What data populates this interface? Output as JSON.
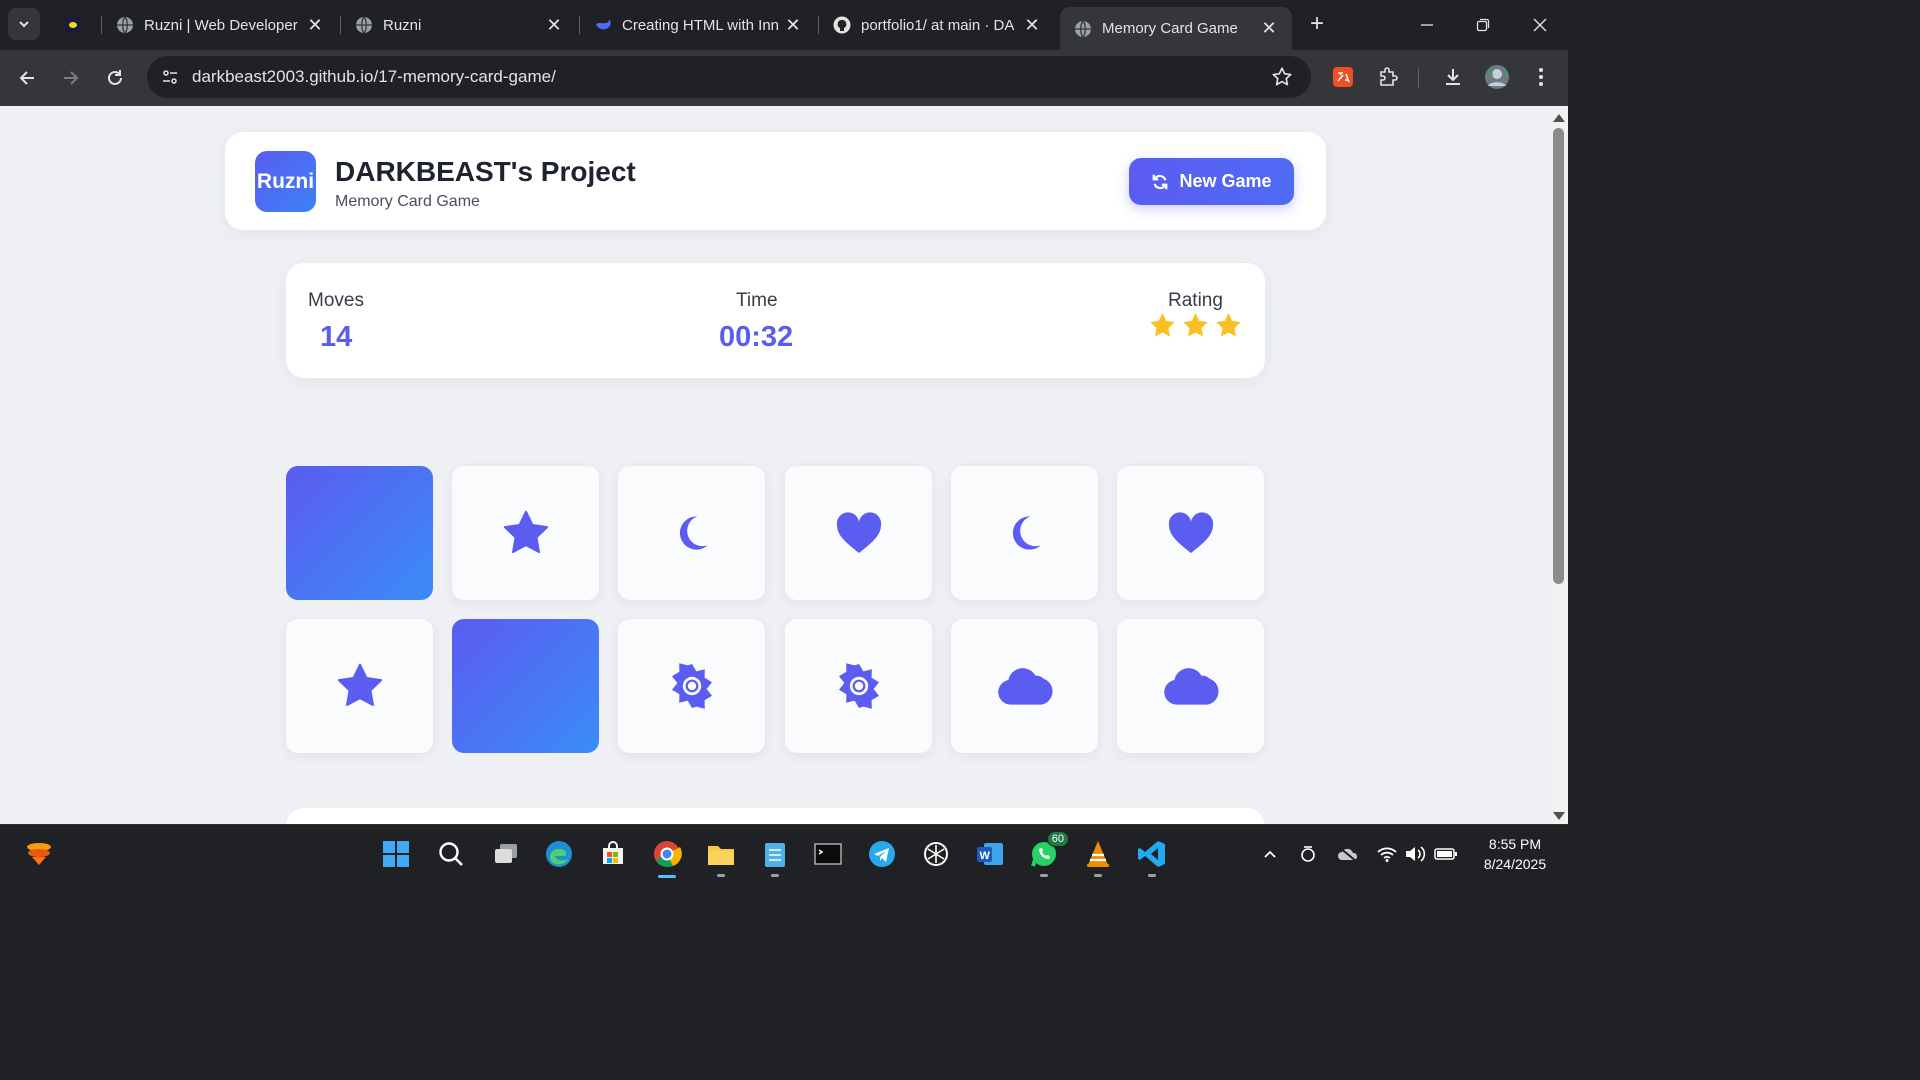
{
  "browser": {
    "tabs": [
      {
        "title": "",
        "active": false
      },
      {
        "title": "Ruzni | Web Developer",
        "active": false
      },
      {
        "title": "Ruzni",
        "active": false
      },
      {
        "title": "Creating HTML with Inn",
        "active": false
      },
      {
        "title": "portfolio1/ at main · DA",
        "active": false
      },
      {
        "title": "Memory Card Game",
        "active": true
      }
    ],
    "url": "darkbeast2003.github.io/17-memory-card-game/"
  },
  "header": {
    "logo_text": "Ruzni",
    "title": "DARKBEAST's Project",
    "subtitle": "Memory Card Game",
    "new_game_label": "New Game"
  },
  "stats": {
    "moves_label": "Moves",
    "moves_value": "14",
    "time_label": "Time",
    "time_value": "00:32",
    "rating_label": "Rating",
    "rating_stars": 3
  },
  "cards": [
    {
      "state": "hidden",
      "icon": ""
    },
    {
      "state": "revealed",
      "icon": "star-icon"
    },
    {
      "state": "revealed",
      "icon": "moon-icon"
    },
    {
      "state": "revealed",
      "icon": "heart-icon"
    },
    {
      "state": "revealed",
      "icon": "moon-icon"
    },
    {
      "state": "revealed",
      "icon": "heart-icon"
    },
    {
      "state": "revealed",
      "icon": "star-icon"
    },
    {
      "state": "hidden",
      "icon": ""
    },
    {
      "state": "revealed",
      "icon": "sun-icon"
    },
    {
      "state": "revealed",
      "icon": "sun-icon"
    },
    {
      "state": "revealed",
      "icon": "cloud-icon"
    },
    {
      "state": "revealed",
      "icon": "cloud-icon"
    }
  ],
  "colors": {
    "accent": "#5b5cf0",
    "card_back_start": "#5b5cf0",
    "card_back_end": "#3b8cf7",
    "star": "#fbbf24"
  },
  "taskbar": {
    "whatsapp_badge": "60",
    "time": "8:55 PM",
    "date": "8/24/2025"
  }
}
